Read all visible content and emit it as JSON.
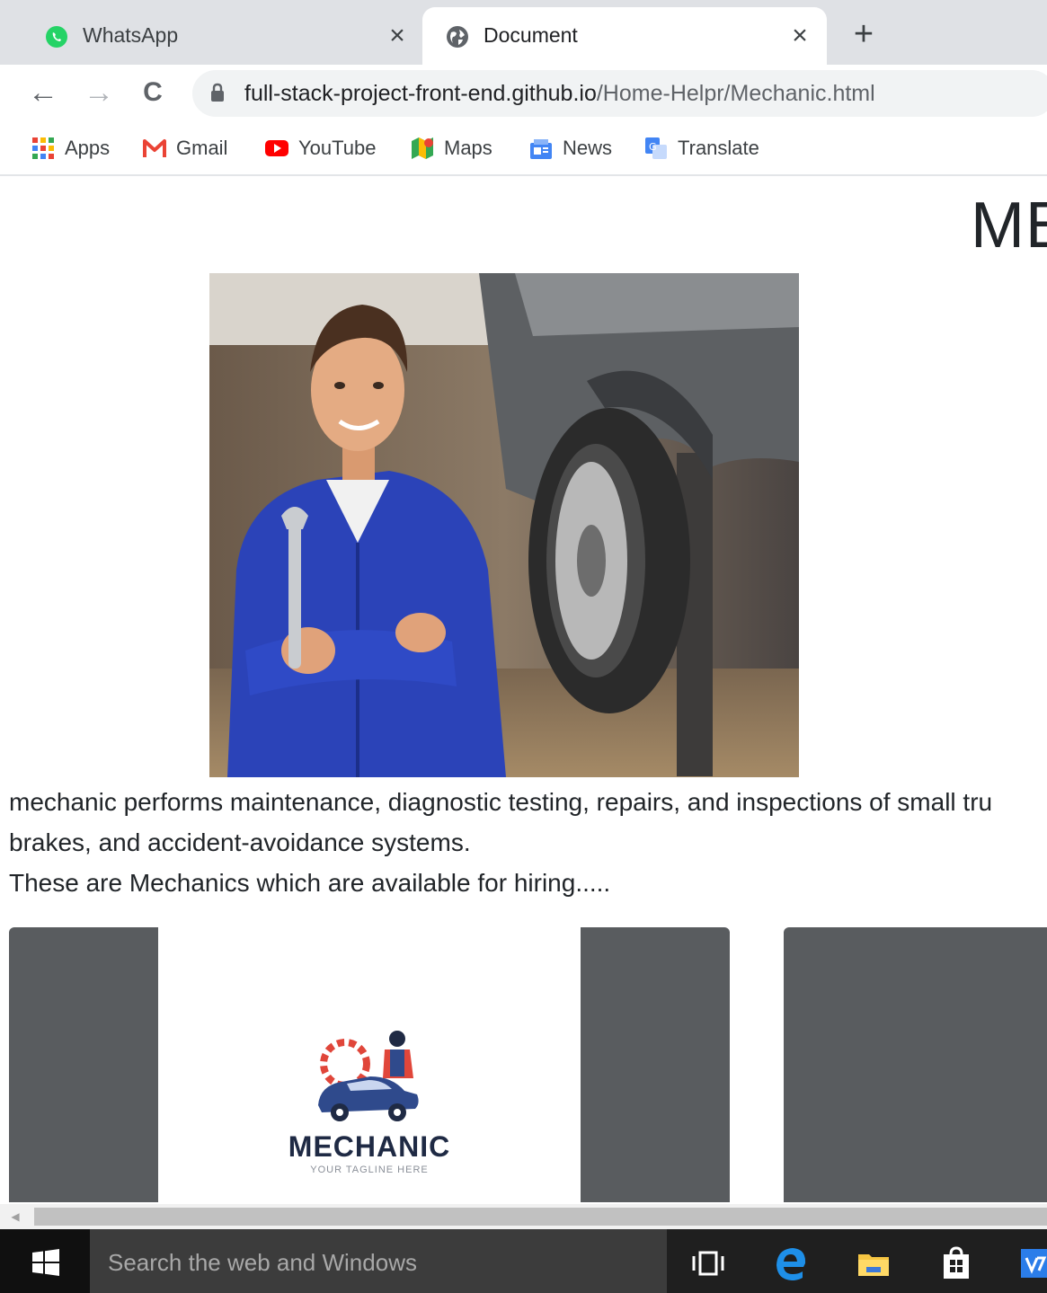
{
  "browser": {
    "tabs": [
      {
        "title": "WhatsApp",
        "icon": "whatsapp-icon",
        "active": false
      },
      {
        "title": "Document",
        "icon": "globe-icon",
        "active": true
      }
    ],
    "close_glyph": "×",
    "new_tab_glyph": "+",
    "url_host": "full-stack-project-front-end.github.io",
    "url_path": "/Home-Helpr/Mechanic.html",
    "nav": {
      "back": "←",
      "forward": "→",
      "reload": "C"
    }
  },
  "bookmarks": [
    {
      "label": "Apps",
      "icon": "apps-grid-icon"
    },
    {
      "label": "Gmail",
      "icon": "gmail-icon"
    },
    {
      "label": "YouTube",
      "icon": "youtube-icon"
    },
    {
      "label": "Maps",
      "icon": "maps-icon"
    },
    {
      "label": "News",
      "icon": "news-icon"
    },
    {
      "label": "Translate",
      "icon": "translate-icon"
    }
  ],
  "page": {
    "heading": "ME",
    "description_line1": "mechanic performs maintenance, diagnostic testing, repairs, and inspections of small tru",
    "description_line2": "brakes, and accident-avoidance systems.",
    "description_line3": "These are Mechanics which are available for hiring.....",
    "card_logo_title": "MECHANIC",
    "card_logo_tagline": "YOUR TAGLINE HERE"
  },
  "taskbar": {
    "search_placeholder": "Search the web and Windows",
    "icons": [
      "task-view-icon",
      "edge-icon",
      "file-explorer-icon",
      "store-icon",
      "app-icon"
    ]
  },
  "colors": {
    "tabstrip": "#dfe1e5",
    "card": "#595c5f",
    "taskbar": "#1f1f1f",
    "whatsapp": "#25d366",
    "youtube": "#ff0000"
  }
}
